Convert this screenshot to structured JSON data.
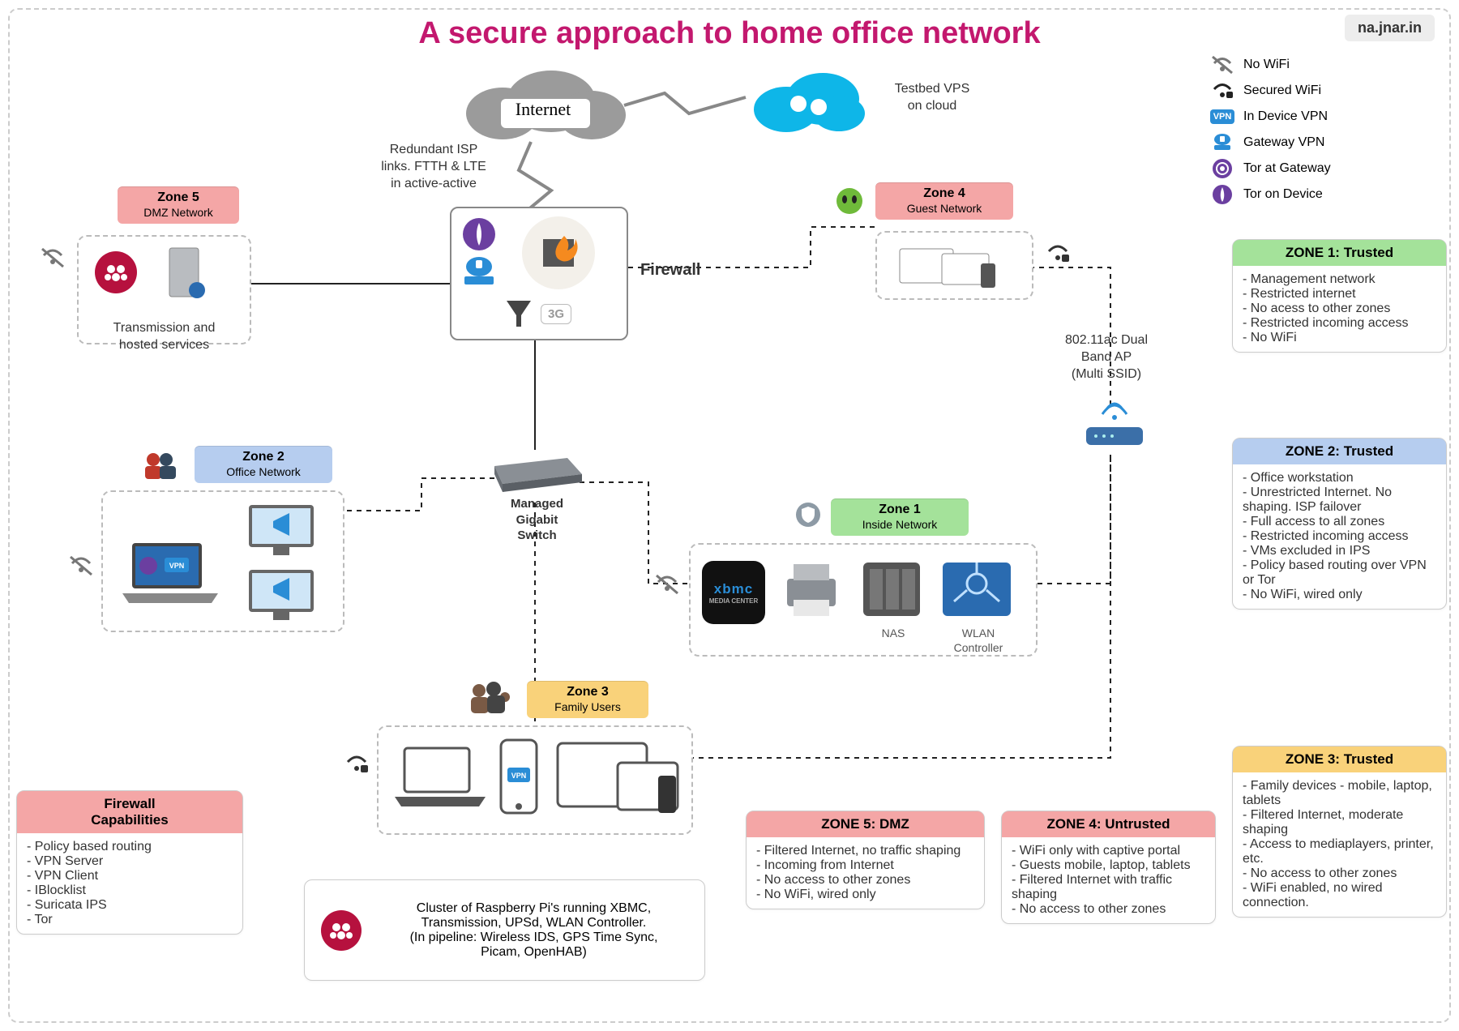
{
  "title": "A secure approach to home office network",
  "watermark": "na.jnar.in",
  "legend": [
    {
      "icon": "wifi-off",
      "label": "No WiFi"
    },
    {
      "icon": "wifi-lock",
      "label": "Secured WiFi"
    },
    {
      "icon": "vpn-badge",
      "label": "In Device VPN"
    },
    {
      "icon": "gateway-vpn",
      "label": "Gateway VPN"
    },
    {
      "icon": "tor-gateway",
      "label": "Tor at Gateway"
    },
    {
      "icon": "tor-device",
      "label": "Tor on Device"
    }
  ],
  "internet": {
    "label": "Internet"
  },
  "testbed": {
    "label": "Testbed VPS\non cloud"
  },
  "isp_note": "Redundant ISP\nlinks. FTTH & LTE\nin active-active",
  "firewall": {
    "label": "Firewall"
  },
  "switch": {
    "label": "Managed\nGigabit\nSwitch"
  },
  "ap_note": "802.11ac Dual\nBand AP\n(Multi SSID)",
  "zones": {
    "z1": {
      "name": "Zone 1",
      "sub": "Inside Network",
      "nas": "NAS",
      "wlan": "WLAN\nController"
    },
    "z2": {
      "name": "Zone 2",
      "sub": "Office Network"
    },
    "z3": {
      "name": "Zone 3",
      "sub": "Family Users"
    },
    "z4": {
      "name": "Zone 4",
      "sub": "Guest Network"
    },
    "z5": {
      "name": "Zone 5",
      "sub": "DMZ Network",
      "caption": "Transmission and\nhosted services"
    }
  },
  "cluster_note": "Cluster of Raspberry Pi's running XBMC,\nTransmission, UPSd, WLAN Controller.\n(In pipeline: Wireless IDS, GPS Time Sync,\nPicam, OpenHAB)",
  "panels": {
    "fw": {
      "title": "Firewall\nCapabilities",
      "items": [
        "Policy based routing",
        "VPN Server",
        "VPN Client",
        "IBlocklist",
        "Suricata IPS",
        "Tor"
      ]
    },
    "z1": {
      "title": "ZONE 1: Trusted",
      "items": [
        "Management network",
        "Restricted internet",
        "No acess to other zones",
        "Restricted incoming access",
        "No WiFi"
      ]
    },
    "z2": {
      "title": "ZONE 2: Trusted",
      "items": [
        "Office workstation",
        "Unrestricted Internet. No shaping. ISP failover",
        "Full access to all zones",
        "Restricted incoming access",
        "VMs excluded in IPS",
        "Policy based routing over VPN or Tor",
        "No WiFi, wired only"
      ]
    },
    "z3": {
      "title": "ZONE 3: Trusted",
      "items": [
        "Family devices - mobile, laptop, tablets",
        "Filtered Internet, moderate shaping",
        "Access to mediaplayers, printer, etc.",
        "No access to other zones",
        "WiFi enabled, no wired connection."
      ]
    },
    "z4": {
      "title": "ZONE 4: Untrusted",
      "items": [
        "WiFi only with captive portal",
        "Guests mobile, laptop, tablets",
        "Filtered Internet with traffic shaping",
        "No access to other zones"
      ]
    },
    "z5": {
      "title": "ZONE 5: DMZ",
      "items": [
        "Filtered Internet, no traffic shaping",
        "Incoming from Internet",
        "No access to other zones",
        "No WiFi, wired only"
      ]
    }
  }
}
